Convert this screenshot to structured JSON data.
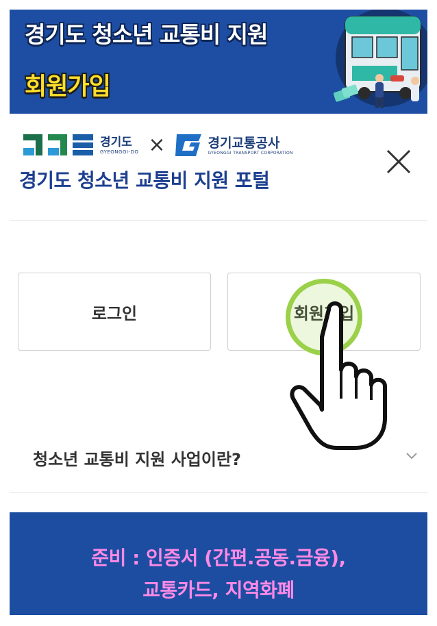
{
  "banner": {
    "title": "경기도 청소년 교통비 지원",
    "subtitle": "회원가입",
    "illustration_icon": "bus-icon"
  },
  "header": {
    "gyeonggi_logo_name": "경기도",
    "gyeonggi_logo_eng": "GYEONGGI-DO",
    "times_sign": "×",
    "gtc_logo_name": "경기교통공사",
    "gtc_logo_eng": "GYEONGGI TRANSPORT CORPORATION",
    "portal_title": "경기도 청소년 교통비 지원 포털",
    "close_icon": "close-icon"
  },
  "main": {
    "login_label": "로그인",
    "signup_label": "회원가입",
    "tap_indicator_icon": "pointing-hand-icon",
    "faq_label": "청소년 교통비 지원 사업이란?",
    "faq_icon": "chevron-down-icon"
  },
  "notice": {
    "line1": "준비 :  인증서 (간편.공동.금융),",
    "line2": "교통카드,  지역화폐"
  },
  "colors": {
    "banner_bg": "#1e4ea3",
    "banner_subtitle": "#ffdf2a",
    "portal_title": "#1d3f8f",
    "notice_bg": "#1c4da1",
    "notice_text": "#ff8ae6",
    "tap_highlight": "#9bd14a"
  }
}
